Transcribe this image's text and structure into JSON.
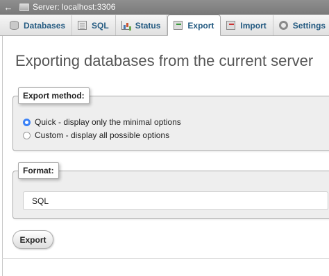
{
  "topbar": {
    "back_icon": "arrow-left-icon",
    "server_icon": "server-icon",
    "server_label": "Server: localhost:3306"
  },
  "tabs": [
    {
      "label": "Databases",
      "icon": "database-icon",
      "active": false
    },
    {
      "label": "SQL",
      "icon": "sql-icon",
      "active": false
    },
    {
      "label": "Status",
      "icon": "status-chart-icon",
      "active": false
    },
    {
      "label": "Export",
      "icon": "export-icon",
      "active": true
    },
    {
      "label": "Import",
      "icon": "import-icon",
      "active": false
    },
    {
      "label": "Settings",
      "icon": "settings-icon",
      "active": false
    }
  ],
  "page": {
    "title": "Exporting databases from the current server"
  },
  "export_method": {
    "legend": "Export method:",
    "options": [
      {
        "label": "Quick - display only the minimal options",
        "selected": true
      },
      {
        "label": "Custom - display all possible options",
        "selected": false
      }
    ]
  },
  "format": {
    "legend": "Format:",
    "selected": "SQL"
  },
  "actions": {
    "export_label": "Export"
  },
  "colors": {
    "tab_text": "#235a81",
    "radio_selected": "#3b82f6",
    "fieldset_bg": "#eeeeee"
  }
}
